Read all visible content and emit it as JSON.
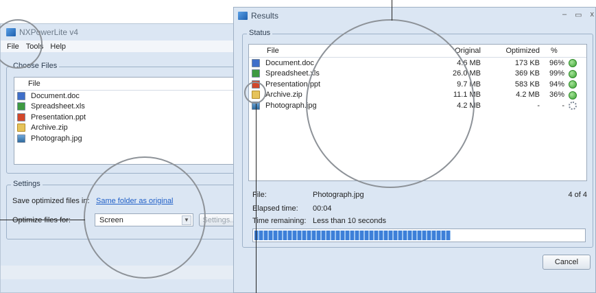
{
  "back_window": {
    "title": "NXPowerLite v4",
    "menu": [
      "File",
      "Tools",
      "Help"
    ],
    "choose_files_label": "Choose Files",
    "file_header": "File",
    "files": [
      {
        "name": "Document.doc",
        "icon": "word-doc-icon"
      },
      {
        "name": "Spreadsheet.xls",
        "icon": "excel-icon"
      },
      {
        "name": "Presentation.ppt",
        "icon": "powerpoint-icon"
      },
      {
        "name": "Archive.zip",
        "icon": "zip-folder-icon"
      },
      {
        "name": "Photograph.jpg",
        "icon": "image-icon"
      }
    ],
    "settings_label": "Settings",
    "save_label": "Save optimized files in:",
    "save_link": "Same folder as original",
    "optimize_label": "Optimize files for:",
    "optimize_value": "Screen",
    "settings_button": "Settings..."
  },
  "results_window": {
    "title": "Results",
    "minimize": "–",
    "maximize": "▭",
    "close": "x",
    "status_label": "Status",
    "columns": [
      "File",
      "Original",
      "Optimized",
      "%"
    ],
    "rows": [
      {
        "file": "Document.doc",
        "original": "4.6 MB",
        "optimized": "173 KB",
        "pct": "96%",
        "status": "ok-check-icon"
      },
      {
        "file": "Spreadsheet.xls",
        "original": "26.0 MB",
        "optimized": "369 KB",
        "pct": "99%",
        "status": "ok-check-icon"
      },
      {
        "file": "Presentation.ppt",
        "original": "9.7 MB",
        "optimized": "583 KB",
        "pct": "94%",
        "status": "ok-check-icon"
      },
      {
        "file": "Archive.zip",
        "original": "11.1 MB",
        "optimized": "4.2 MB",
        "pct": "36%",
        "status": "ok-check-icon"
      },
      {
        "file": "Photograph.jpg",
        "original": "4.2 MB",
        "optimized": "-",
        "pct": "-",
        "status": "processing-gear-icon"
      }
    ],
    "file_label": "File:",
    "file_value": "Photograph.jpg",
    "count": "4 of 4",
    "elapsed_label": "Elapsed time:",
    "elapsed_value": "00:04",
    "remaining_label": "Time remaining:",
    "remaining_value": "Less than 10 seconds",
    "progress": 0.6,
    "cancel": "Cancel"
  }
}
